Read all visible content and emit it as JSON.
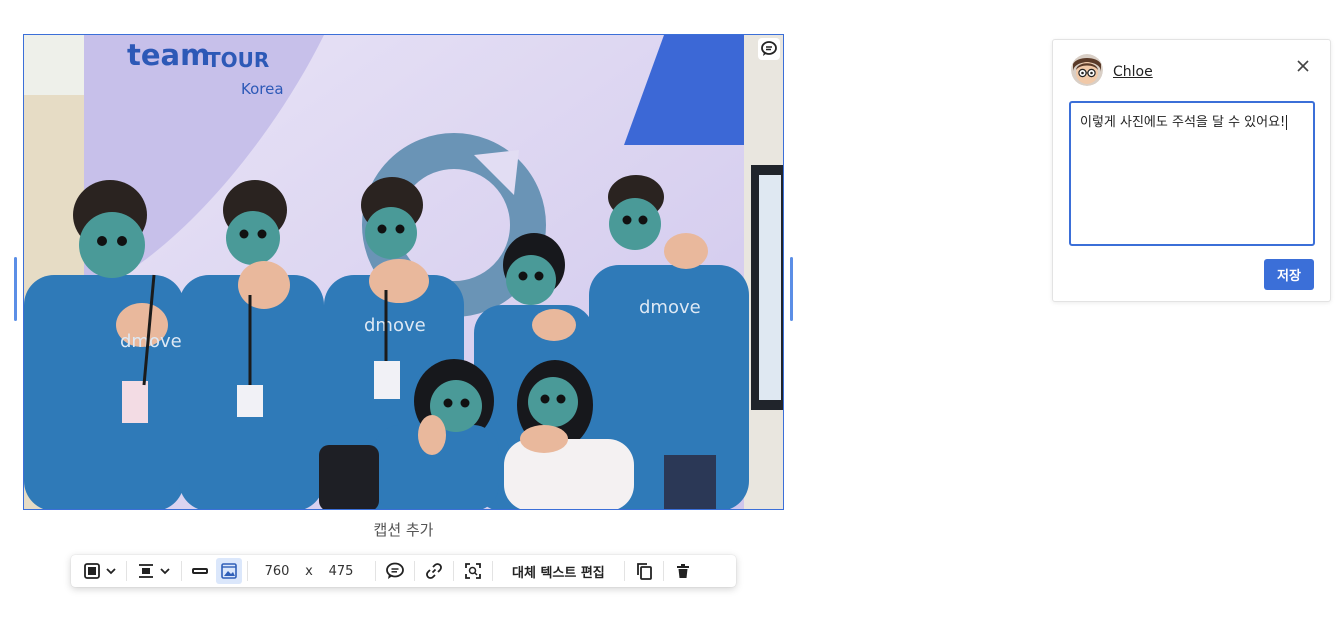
{
  "image": {
    "banner_brand_team": "team",
    "banner_brand_tour": "TOUR",
    "banner_brand_country": "Korea",
    "shirt_text": "dmove"
  },
  "caption": {
    "placeholder": "캡션 추가"
  },
  "toolbar": {
    "width_value": "760",
    "dimension_separator": "x",
    "height_value": "475",
    "alt_text_label": "대체 텍스트 편집"
  },
  "comment": {
    "username": "Chloe",
    "text": "이렇게 사진에도 주석을 달 수 있어요!",
    "save_label": "저장"
  },
  "colors": {
    "accent": "#3b6fd8",
    "shirt": "#2f7ab8",
    "face_mask": "#4a9a98"
  },
  "icons": {
    "close": "close-icon",
    "comment": "comment-icon",
    "link": "link-icon"
  }
}
